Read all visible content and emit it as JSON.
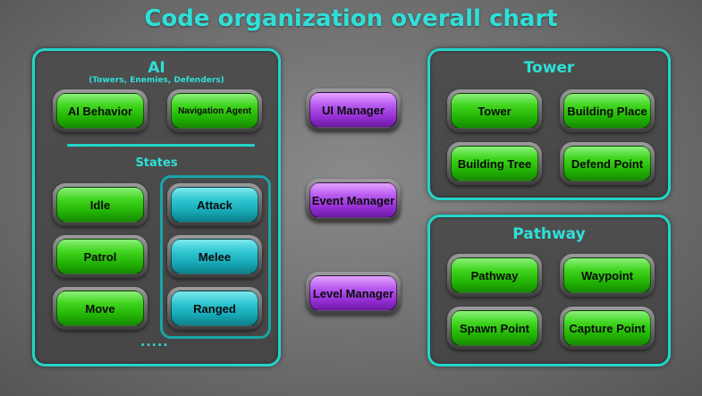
{
  "title": "Code organization overall chart",
  "ai_panel": {
    "title": "AI",
    "subtitle": "(Towers, Enemies, Defenders)",
    "top_buttons": [
      "AI Behavior",
      "Navigation Agent"
    ],
    "states_label": "States",
    "state_buttons": [
      "Idle",
      "Patrol",
      "Move"
    ],
    "attack_buttons": [
      "Attack",
      "Melee",
      "Ranged"
    ],
    "more": "....."
  },
  "managers": [
    "UI Manager",
    "Event Manager",
    "Level Manager"
  ],
  "tower_panel": {
    "title": "Tower",
    "buttons": [
      "Tower",
      "Building Place",
      "Building Tree",
      "Defend Point"
    ]
  },
  "pathway_panel": {
    "title": "Pathway",
    "buttons": [
      "Pathway",
      "Waypoint",
      "Spawn Point",
      "Capture Point"
    ]
  },
  "colors": {
    "accent": "#21d6c8",
    "green": "#3fd51d",
    "cyan": "#2fc7d2",
    "purple": "#b85cf0",
    "panel": "#4a4a4a"
  }
}
